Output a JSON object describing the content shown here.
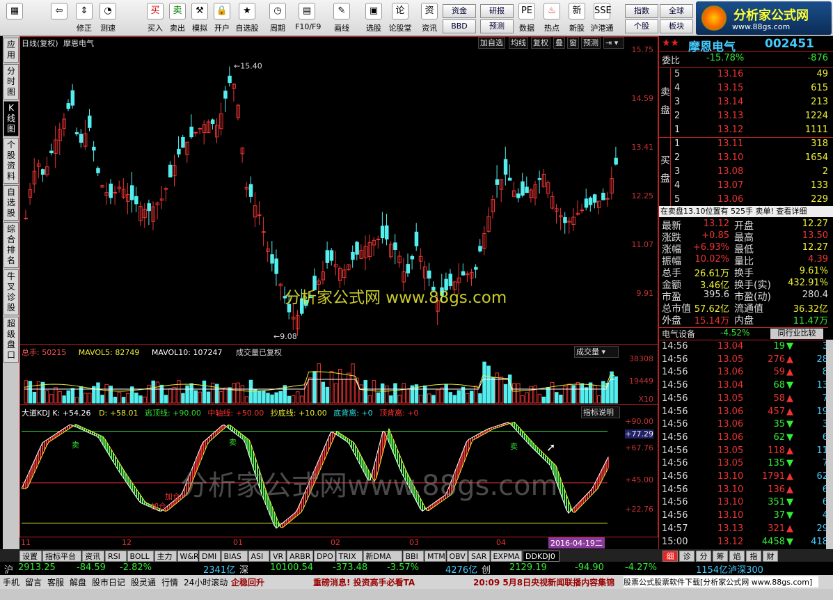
{
  "toolbar": {
    "buttons": [
      {
        "label": "",
        "icon": "grid"
      },
      {
        "label": "",
        "icon": "arrow-left"
      },
      {
        "label": "修正",
        "icon": "arrow-updown"
      },
      {
        "label": "测速",
        "icon": "gauge"
      },
      {
        "label": "买入",
        "icon": "buy"
      },
      {
        "label": "卖出",
        "icon": "sell"
      },
      {
        "label": "模拟",
        "icon": "hammer"
      },
      {
        "label": "开户",
        "icon": "lock"
      },
      {
        "label": "自选股",
        "icon": "star"
      },
      {
        "label": "周期",
        "icon": "clock"
      },
      {
        "label": "F10/F9",
        "icon": "doc"
      },
      {
        "label": "画线",
        "icon": "pen"
      },
      {
        "label": "选股",
        "icon": "select"
      },
      {
        "label": "论股堂",
        "icon": "chat"
      },
      {
        "label": "资讯",
        "icon": "news"
      },
      {
        "label": "数据",
        "icon": "pe"
      },
      {
        "label": "热点",
        "icon": "hot"
      },
      {
        "label": "新股",
        "icon": "ipo"
      },
      {
        "label": "沪港通",
        "icon": "hk"
      }
    ],
    "squares": [
      "资金",
      "研报",
      "BBD",
      "预测",
      "指数",
      "全球",
      "个股",
      "板块"
    ],
    "brand": "分析家公式网",
    "brand_url": "www.88gs.com"
  },
  "side_tabs": [
    "应用",
    "分时图",
    "K线图",
    "个股资料",
    "自选股",
    "综合排名",
    "牛叉诊股",
    "超级盘口"
  ],
  "chart": {
    "period": "日线(复权)",
    "name": "摩恩电气",
    "buttons": [
      "加自选",
      "均线",
      "复权",
      "叠",
      "窗",
      "预测"
    ],
    "price_labels": [
      "15.75",
      "14.59",
      "13.41",
      "12.25",
      "11.07",
      "9.91"
    ],
    "max_label": "15.40",
    "min_label": "9.08",
    "watermark": "分析家公式网 www.88gs.com",
    "vol_header": {
      "a": "总手: 50215",
      "b": "MAVOL5: 82749",
      "c": "MAVOL10: 107247",
      "d": "成交量已复权",
      "btn": "成交量"
    },
    "vol_labels": [
      "38308",
      "19449",
      "X10"
    ],
    "kdj_header": {
      "a": "大道KDJ K: +54.26",
      "b": "D: +58.01",
      "c": "逃顶线: +90.00",
      "d": "中轴线: +50.00",
      "e": "抄底线: +10.00",
      "f": "底背离: +0",
      "g": "顶背离: +0",
      "btn": "指标说明"
    },
    "kdj_labels": [
      "+90.00",
      "+77.29",
      "+67.76",
      "+45.00",
      "+22.76"
    ],
    "kdj_marks": [
      "卖",
      "卖",
      "加仓",
      "加仓",
      "卖",
      "卖"
    ],
    "kdj_watermark": "分析家公式网www.88gs.com",
    "x_labels": [
      "11",
      "12",
      "01",
      "02",
      "03",
      "04"
    ],
    "date_sel": "2016-04-19二"
  },
  "chart_data": {
    "type": "candlestick",
    "title": "摩恩电气",
    "period": "日线(复权)",
    "y_ticks": [
      15.75,
      14.59,
      13.41,
      12.25,
      11.07,
      9.91
    ],
    "high": 15.4,
    "low": 9.08,
    "volume": {
      "total": 50215,
      "mavol5": 82749,
      "mavol10": 107247
    },
    "kdj": {
      "K": 54.26,
      "D": 58.01,
      "top": 90,
      "mid": 50,
      "bottom": 10
    }
  },
  "quote": {
    "name": "摩恩电气",
    "code": "002451",
    "weibi": "委比",
    "weibi_pct": "-15.78%",
    "weibi_diff": "-876",
    "asks": [
      [
        "5",
        "13.16",
        "49"
      ],
      [
        "4",
        "13.15",
        "615"
      ],
      [
        "3",
        "13.14",
        "213"
      ],
      [
        "2",
        "13.13",
        "1224"
      ],
      [
        "1",
        "13.12",
        "1111"
      ]
    ],
    "bids": [
      [
        "1",
        "13.11",
        "318"
      ],
      [
        "2",
        "13.10",
        "1654"
      ],
      [
        "3",
        "13.08",
        "2"
      ],
      [
        "4",
        "13.07",
        "133"
      ],
      [
        "5",
        "13.06",
        "229"
      ]
    ],
    "ask_label": "卖盘",
    "bid_label": "买盘",
    "info_bar": "在卖盘13.10位置有 525手 卖单! 查看详细",
    "stats": [
      [
        "最新",
        "13.12",
        "开盘",
        "12.27"
      ],
      [
        "涨跌",
        "+0.85",
        "最高",
        "13.50"
      ],
      [
        "涨幅",
        "+6.93%",
        "最低",
        "12.27"
      ],
      [
        "振幅",
        "10.02%",
        "量比",
        "4.39"
      ],
      [
        "总手",
        "26.61万",
        "换手",
        "9.61%"
      ],
      [
        "金额",
        "3.46亿",
        "换手(实)",
        "432.91%"
      ],
      [
        "市盈",
        "395.6",
        "市盈(动)",
        "280.4"
      ],
      [
        "总市值",
        "57.62亿",
        "流通值",
        "36.32亿"
      ],
      [
        "外盘",
        "15.14万",
        "内盘",
        "11.47万"
      ]
    ],
    "sector": "电气设备",
    "sector_pct": "-4.52%",
    "compare": "同行业比较",
    "ticks": [
      [
        "14:56",
        "13.04",
        "19",
        "3"
      ],
      [
        "14:56",
        "13.05",
        "276",
        "28"
      ],
      [
        "14:56",
        "13.06",
        "59",
        "8"
      ],
      [
        "14:56",
        "13.04",
        "68",
        "13"
      ],
      [
        "14:56",
        "13.05",
        "58",
        "7"
      ],
      [
        "14:56",
        "13.06",
        "457",
        "19"
      ],
      [
        "14:56",
        "13.06",
        "35",
        "3"
      ],
      [
        "14:56",
        "13.06",
        "62",
        "6"
      ],
      [
        "14:56",
        "13.05",
        "118",
        "11"
      ],
      [
        "14:56",
        "13.05",
        "135",
        "7"
      ],
      [
        "14:56",
        "13.10",
        "1791",
        "62"
      ],
      [
        "14:56",
        "13.10",
        "136",
        "6"
      ],
      [
        "14:56",
        "13.10",
        "351",
        "6"
      ],
      [
        "14:56",
        "13.10",
        "37",
        "4"
      ],
      [
        "14:57",
        "13.13",
        "321",
        "29"
      ],
      [
        "15:00",
        "13.12",
        "4458",
        "418"
      ]
    ]
  },
  "formula_tabs": [
    "设置",
    "指标平台",
    "资讯",
    "RSI",
    "BOLL",
    "主力",
    "W&R",
    "DMI",
    "BIAS",
    "ASI",
    "VR",
    "ARBR",
    "DPO",
    "TRIX",
    "新DMA",
    "BBI",
    "MTM",
    "OBV",
    "SAR",
    "EXPMA",
    "DDKDJ0"
  ],
  "right_tabs": [
    "细",
    "诊",
    "分",
    "筹",
    "焰",
    "指",
    "财"
  ],
  "index_bar": {
    "sh": "沪",
    "sh_val": "2913.25",
    "sh_chg": "-84.59",
    "sh_pct": "-2.82%",
    "sh_amt": "2341亿",
    "sz": "深",
    "sz_val": "10100.54",
    "sz_chg": "-373.48",
    "sz_pct": "-3.57%",
    "sz_amt": "4276亿",
    "cy": "创",
    "cy_val": "2129.19",
    "cy_chg": "-94.90",
    "cy_pct": "-4.27%",
    "right": "1154亿泸深300"
  },
  "status_bar": {
    "items": [
      "手机",
      "留言",
      "客服",
      "解盘",
      "股市日记",
      "股灵通",
      "行情",
      "24小时滚动"
    ],
    "msg1": "企稳回升",
    "msg2": "重磅消息! 投资高手必看TA",
    "msg3": "20:09 5月8日央视新闻联播内容集锦",
    "msg4": "股票公式股票软件下载[分析家公式网 www.88gs.com]"
  }
}
